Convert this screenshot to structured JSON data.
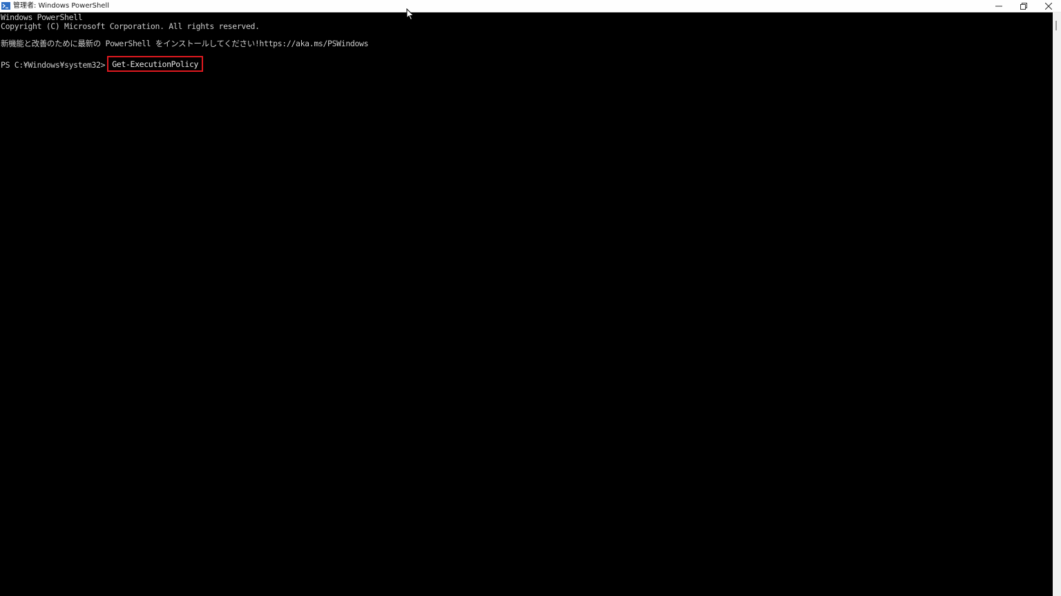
{
  "window": {
    "title": "管理者: Windows PowerShell",
    "icon": "powershell-icon",
    "controls": {
      "minimize_icon": "minimize-icon",
      "maximize_icon": "restore-icon",
      "close_icon": "close-icon"
    }
  },
  "console": {
    "lines": [
      "Windows PowerShell",
      "Copyright (C) Microsoft Corporation. All rights reserved.",
      "新機能と改善のために最新の PowerShell をインストールしてください!https://aka.ms/PSWindows"
    ],
    "prompt": "PS C:¥Windows¥system32>",
    "command": "Get-ExecutionPolicy",
    "highlight_color": "#e0191f",
    "text_color": "#cccccc",
    "background_color": "#000000"
  }
}
